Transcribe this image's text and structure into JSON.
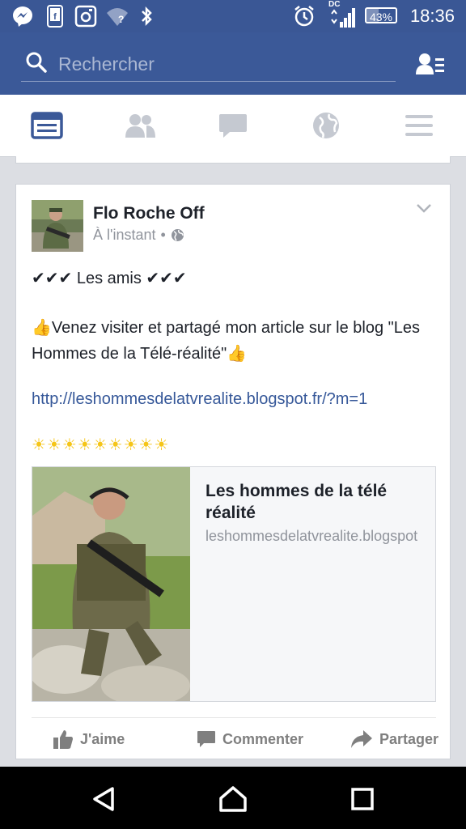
{
  "status_bar": {
    "time": "18:36",
    "battery": "43%",
    "battery_level": 0.43,
    "network_label": "DC",
    "icons": [
      "messenger-icon",
      "facebook-app-icon",
      "instagram-icon",
      "wifi-icon",
      "bluetooth-icon",
      "alarm-icon",
      "signal-icon",
      "battery-icon"
    ]
  },
  "search": {
    "placeholder": "Rechercher"
  },
  "tabs": [
    "news-feed-icon",
    "friends-icon",
    "messages-icon",
    "notifications-globe-icon",
    "menu-icon"
  ],
  "post": {
    "author": "Flo Roche Off",
    "time": "À l'instant",
    "separator": "•",
    "line1": "✔✔✔ Les amis ✔✔✔",
    "line2": "👍Venez visiter et partagé mon article sur le blog \"Les Hommes de la Télé-réalité\"👍",
    "url": "http://leshommesdelatvrealite.blogspot.fr/?m=1",
    "suns": "☀☀☀☀☀☀☀☀☀",
    "preview": {
      "title": "Les hommes de la télé réalité",
      "domain": "leshommesdelatvrealite.blogspot"
    },
    "actions": {
      "like": "J'aime",
      "comment": "Commenter",
      "share": "Partager"
    }
  },
  "colors": {
    "brand": "#3b5998",
    "statusbar": "#3a5795",
    "active_tab": "#3b5998",
    "inactive_tab": "#c5c9d1",
    "link": "#365899",
    "sun": "#f5c518"
  }
}
